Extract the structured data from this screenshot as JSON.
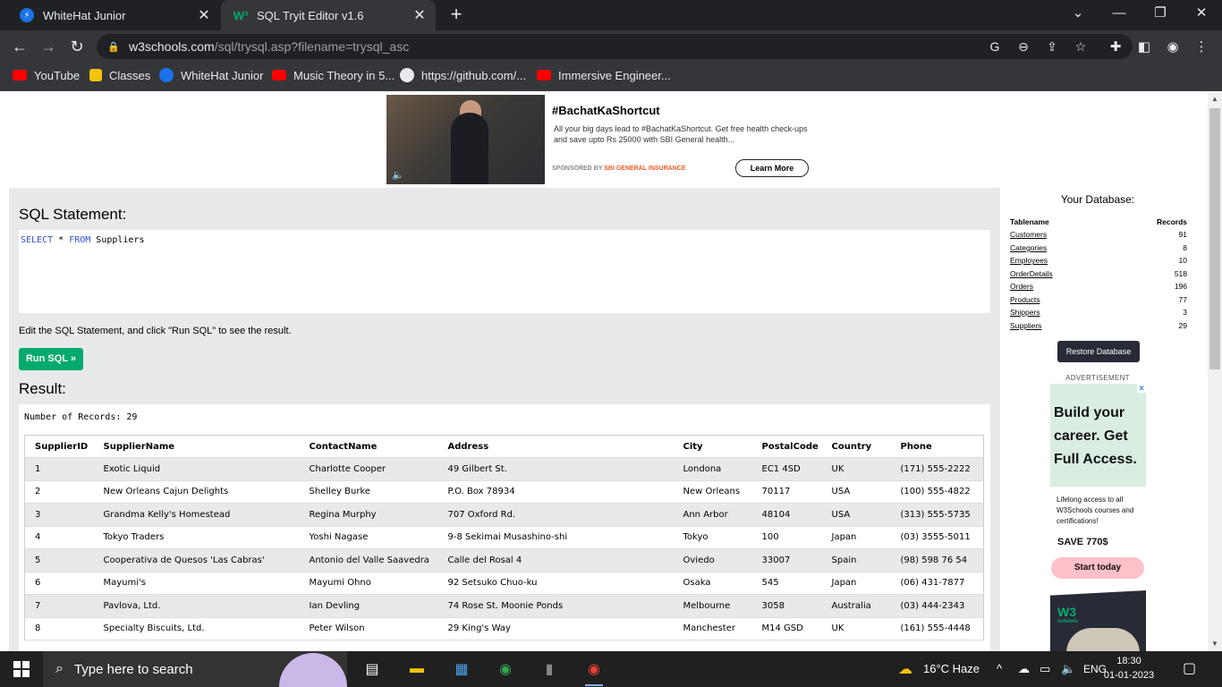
{
  "browser": {
    "tabs": [
      {
        "title": "WhiteHat Junior",
        "active": false
      },
      {
        "title": "SQL Tryit Editor v1.6",
        "active": true
      }
    ],
    "url_host": "w3schools.com",
    "url_path": "/sql/trysql.asp?filename=trysql_asc",
    "bookmarks": [
      "YouTube",
      "Classes",
      "WhiteHat Junior",
      "Music Theory in 5...",
      "https://github.com/...",
      "Immersive Engineer..."
    ]
  },
  "ad_top": {
    "title": "#BachatKaShortcut",
    "description": "All your big days lead to #BachatKaShortcut.  Get free health check-ups and save upto Rs 25000 with SBI General health...",
    "sponsored_prefix": "SPONSORED BY",
    "sponsor": "SBI GENERAL INSURANCE",
    "cta": "Learn More"
  },
  "editor": {
    "heading": "SQL Statement:",
    "sql_kw1": "SELECT",
    "sql_star": " * ",
    "sql_kw2": "FROM",
    "sql_rest": " Suppliers",
    "hint": "Edit the SQL Statement, and click \"Run SQL\" to see the result.",
    "run_label": "Run SQL »",
    "result_heading": "Result:",
    "record_count": "Number of Records: 29"
  },
  "result_table": {
    "columns": [
      "SupplierID",
      "SupplierName",
      "ContactName",
      "Address",
      "City",
      "PostalCode",
      "Country",
      "Phone"
    ],
    "rows": [
      [
        "1",
        "Exotic Liquid",
        "Charlotte Cooper",
        "49 Gilbert St.",
        "Londona",
        "EC1 4SD",
        "UK",
        "(171) 555-2222"
      ],
      [
        "2",
        "New Orleans Cajun Delights",
        "Shelley Burke",
        "P.O. Box 78934",
        "New Orleans",
        "70117",
        "USA",
        "(100) 555-4822"
      ],
      [
        "3",
        "Grandma Kelly's Homestead",
        "Regina Murphy",
        "707 Oxford Rd.",
        "Ann Arbor",
        "48104",
        "USA",
        "(313) 555-5735"
      ],
      [
        "4",
        "Tokyo Traders",
        "Yoshi Nagase",
        "9-8 Sekimai Musashino-shi",
        "Tokyo",
        "100",
        "Japan",
        "(03) 3555-5011"
      ],
      [
        "5",
        "Cooperativa de Quesos 'Las Cabras'",
        "Antonio del Valle Saavedra",
        "Calle del Rosal 4",
        "Oviedo",
        "33007",
        "Spain",
        "(98) 598 76 54"
      ],
      [
        "6",
        "Mayumi's",
        "Mayumi Ohno",
        "92 Setsuko Chuo-ku",
        "Osaka",
        "545",
        "Japan",
        "(06) 431-7877"
      ],
      [
        "7",
        "Pavlova, Ltd.",
        "Ian Devling",
        "74 Rose St. Moonie Ponds",
        "Melbourne",
        "3058",
        "Australia",
        "(03) 444-2343"
      ],
      [
        "8",
        "Specialty Biscuits, Ltd.",
        "Peter Wilson",
        "29 King's Way",
        "Manchester",
        "M14 GSD",
        "UK",
        "(161) 555-4448"
      ]
    ]
  },
  "database": {
    "title": "Your Database:",
    "col_name": "Tablename",
    "col_records": "Records",
    "tables": [
      {
        "name": "Customers",
        "records": "91"
      },
      {
        "name": "Categories",
        "records": "8"
      },
      {
        "name": "Employees",
        "records": "10"
      },
      {
        "name": "OrderDetails",
        "records": "518"
      },
      {
        "name": "Orders",
        "records": "196"
      },
      {
        "name": "Products",
        "records": "77"
      },
      {
        "name": "Shippers",
        "records": "3"
      },
      {
        "name": "Suppliers",
        "records": "29"
      }
    ],
    "restore_label": "Restore Database"
  },
  "side_ad": {
    "label": "ADVERTISEMENT",
    "headline": "Build your career. Get Full Access.",
    "body": "Lifelong access to all W3Schools courses and certifications!",
    "save": "SAVE 770$",
    "cta": "Start today",
    "logo": "W3",
    "logo_sub": "schools"
  },
  "taskbar": {
    "search_placeholder": "Type here to search",
    "weather": "16°C  Haze",
    "lang": "ENG",
    "time": "18:30",
    "date": "01-01-2023"
  },
  "colors": {
    "accent": "#04aa6d",
    "chrome_dark": "#202124",
    "chrome_toolbar": "#35363a",
    "panel": "#e7e9eb"
  }
}
